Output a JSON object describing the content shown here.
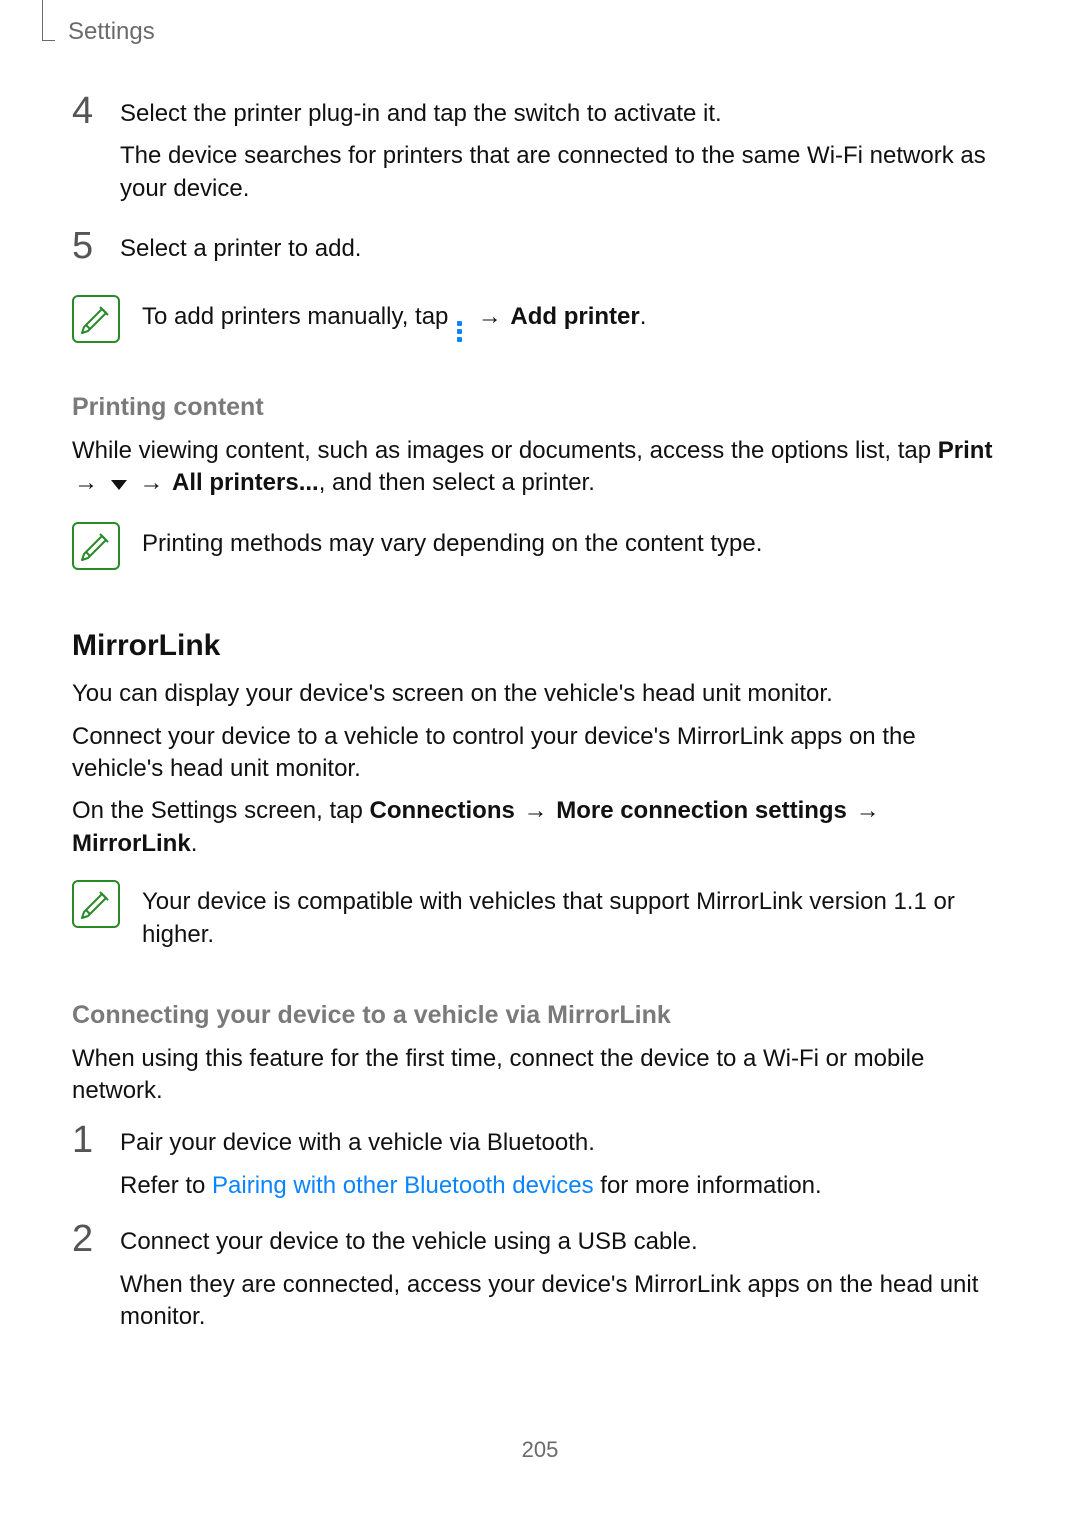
{
  "header": {
    "title": "Settings"
  },
  "steps_top": [
    {
      "num": "4",
      "line1": "Select the printer plug-in and tap the switch to activate it.",
      "line2": "The device searches for printers that are connected to the same Wi-Fi network as your device."
    },
    {
      "num": "5",
      "line1": "Select a printer to add."
    }
  ],
  "note_add_printer": {
    "pre": "To add printers manually, tap ",
    "arrow": "→",
    "bold": "Add printer",
    "post": "."
  },
  "printing_content": {
    "heading": "Printing content",
    "pre": "While viewing content, such as images or documents, access the options list, tap ",
    "print_bold": "Print",
    "arrow1": "→",
    "arrow2": "→",
    "all_printers_bold": "All printers...",
    "post": ", and then select a printer."
  },
  "note_print_methods": "Printing methods may vary depending on the content type.",
  "mirrorlink": {
    "heading": "MirrorLink",
    "p1": "You can display your device's screen on the vehicle's head unit monitor.",
    "p2": "Connect your device to a vehicle to control your device's MirrorLink apps on the vehicle's head unit monitor.",
    "path_pre": "On the Settings screen, tap ",
    "path_b1": "Connections",
    "arrow1": "→",
    "path_b2": "More connection settings",
    "arrow2": "→",
    "path_b3": "MirrorLink",
    "path_post": ".",
    "note": "Your device is compatible with vehicles that support MirrorLink version 1.1 or higher.",
    "sub_heading": "Connecting your device to a vehicle via MirrorLink",
    "sub_intro": "When using this feature for the first time, connect the device to a Wi-Fi or mobile network.",
    "steps": [
      {
        "num": "1",
        "line1": "Pair your device with a vehicle via Bluetooth.",
        "refer_pre": "Refer to ",
        "refer_link": "Pairing with other Bluetooth devices",
        "refer_post": " for more information."
      },
      {
        "num": "2",
        "line1": "Connect your device to the vehicle using a USB cable.",
        "line2": "When they are connected, access your device's MirrorLink apps on the head unit monitor."
      }
    ]
  },
  "page_number": "205"
}
